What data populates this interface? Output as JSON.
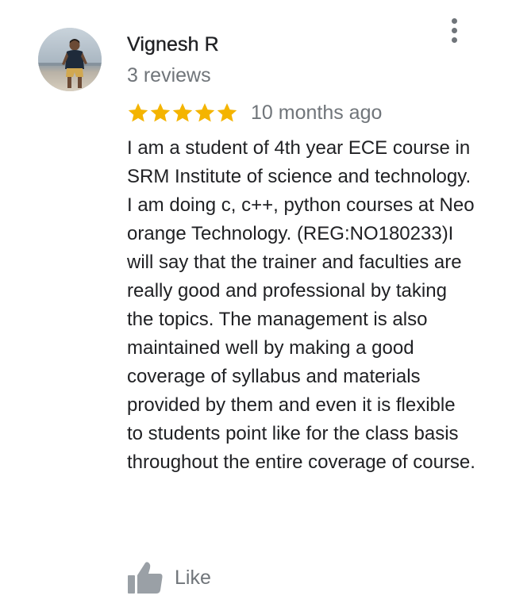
{
  "review": {
    "reviewer_name": "Vignesh R",
    "review_count": "3 reviews",
    "rating": 5,
    "rating_max": 5,
    "date": "10 months ago",
    "text": "I am a student of 4th year ECE course in SRM Institute of science and technology. I am doing c, c++, python courses at Neo orange Technology. (REG:NO180233)I will say that the trainer and faculties are really good and professional by taking the topics. The management is also maintained well by making a good coverage of syllabus and materials provided by them and even it is flexible to students point like for the class basis throughout the entire coverage of course.",
    "like_label": "Like"
  },
  "icons": {
    "avatar": "avatar-photo",
    "more": "more-vert-icon",
    "star": "star-icon",
    "like": "thumbs-up-icon"
  },
  "colors": {
    "star": "#F4B400",
    "text": "#202124",
    "secondary_text": "#70757a",
    "background": "#ffffff"
  }
}
